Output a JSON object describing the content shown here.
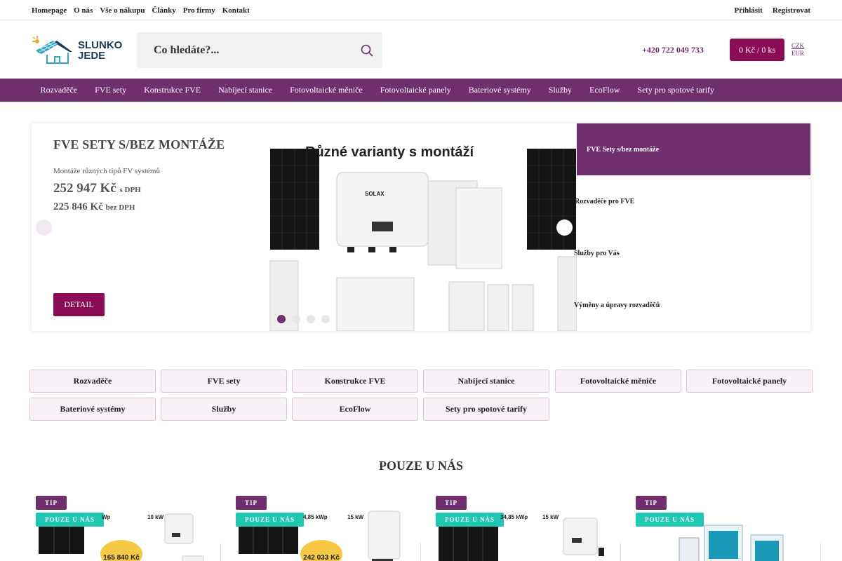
{
  "topnav": {
    "left": [
      "Homepage",
      "O nás",
      "Vše o nákupu",
      "Články",
      "Pro firmy",
      "Kontakt"
    ],
    "login": "Přihlásit",
    "register": "Registrovat"
  },
  "header": {
    "logo_line1": "SLUNKO",
    "logo_line2": "JEDE",
    "search_placeholder": "Co hledáte?...",
    "phone": "+420 722 049 733",
    "cart": "0 Kč / 0 ks",
    "currency_active": "CZK",
    "currency_other": "EUR"
  },
  "mainnav": [
    "Rozvaděče",
    "FVE sety",
    "Konstrukce FVE",
    "Nabíjecí stanice",
    "Fotovoltaické měniče",
    "Fotovoltaické panely",
    "Bateriové systémy",
    "Služby",
    "EcoFlow",
    "Sety pro spotové tarify"
  ],
  "hero": {
    "title": "FVE SETY S/BEZ MONTÁŽE",
    "subtitle": "Montáže různých tipů FV systémů",
    "price_with_vat": "252 947 Kč",
    "with_vat_label": "s DPH",
    "price_without_vat": "225 846 Kč",
    "without_vat_label": "bez DPH",
    "detail_button": "DETAIL",
    "banner_title": "Různé varianty s montáží",
    "banner_brand": "SOLAX",
    "side_tabs": [
      "FVE Sety s/bez montáže",
      "Rozvaděče pro FVE",
      "Služby pro Vás",
      "Výměny a úpravy rozvaděčů"
    ]
  },
  "categories": [
    "Rozvaděče",
    "FVE sety",
    "Konstrukce FVE",
    "Nabíjecí stanice",
    "Fotovoltaické měniče",
    "Fotovoltaické panely",
    "Bateriové systémy",
    "Služby",
    "EcoFlow",
    "Sety pro spotové tarify"
  ],
  "section_title": "POUZE U NÁS",
  "products": [
    {
      "tip": "TIP",
      "only": "POUZE U NÁS",
      "kwp": "Wp",
      "kw": "10 kW",
      "price": "165 840 Kč"
    },
    {
      "tip": "TIP",
      "only": "POUZE U NÁS",
      "kwp": "4,85 kWp",
      "kw": "15 kW",
      "price": "242 033 Kč"
    },
    {
      "tip": "TIP",
      "only": "POUZE U NÁS",
      "kwp": "34,85 kWp",
      "kw": "15 kW",
      "price": ""
    },
    {
      "tip": "TIP",
      "only": "POUZE U NÁS",
      "kwp": "",
      "kw": "",
      "price": ""
    }
  ]
}
